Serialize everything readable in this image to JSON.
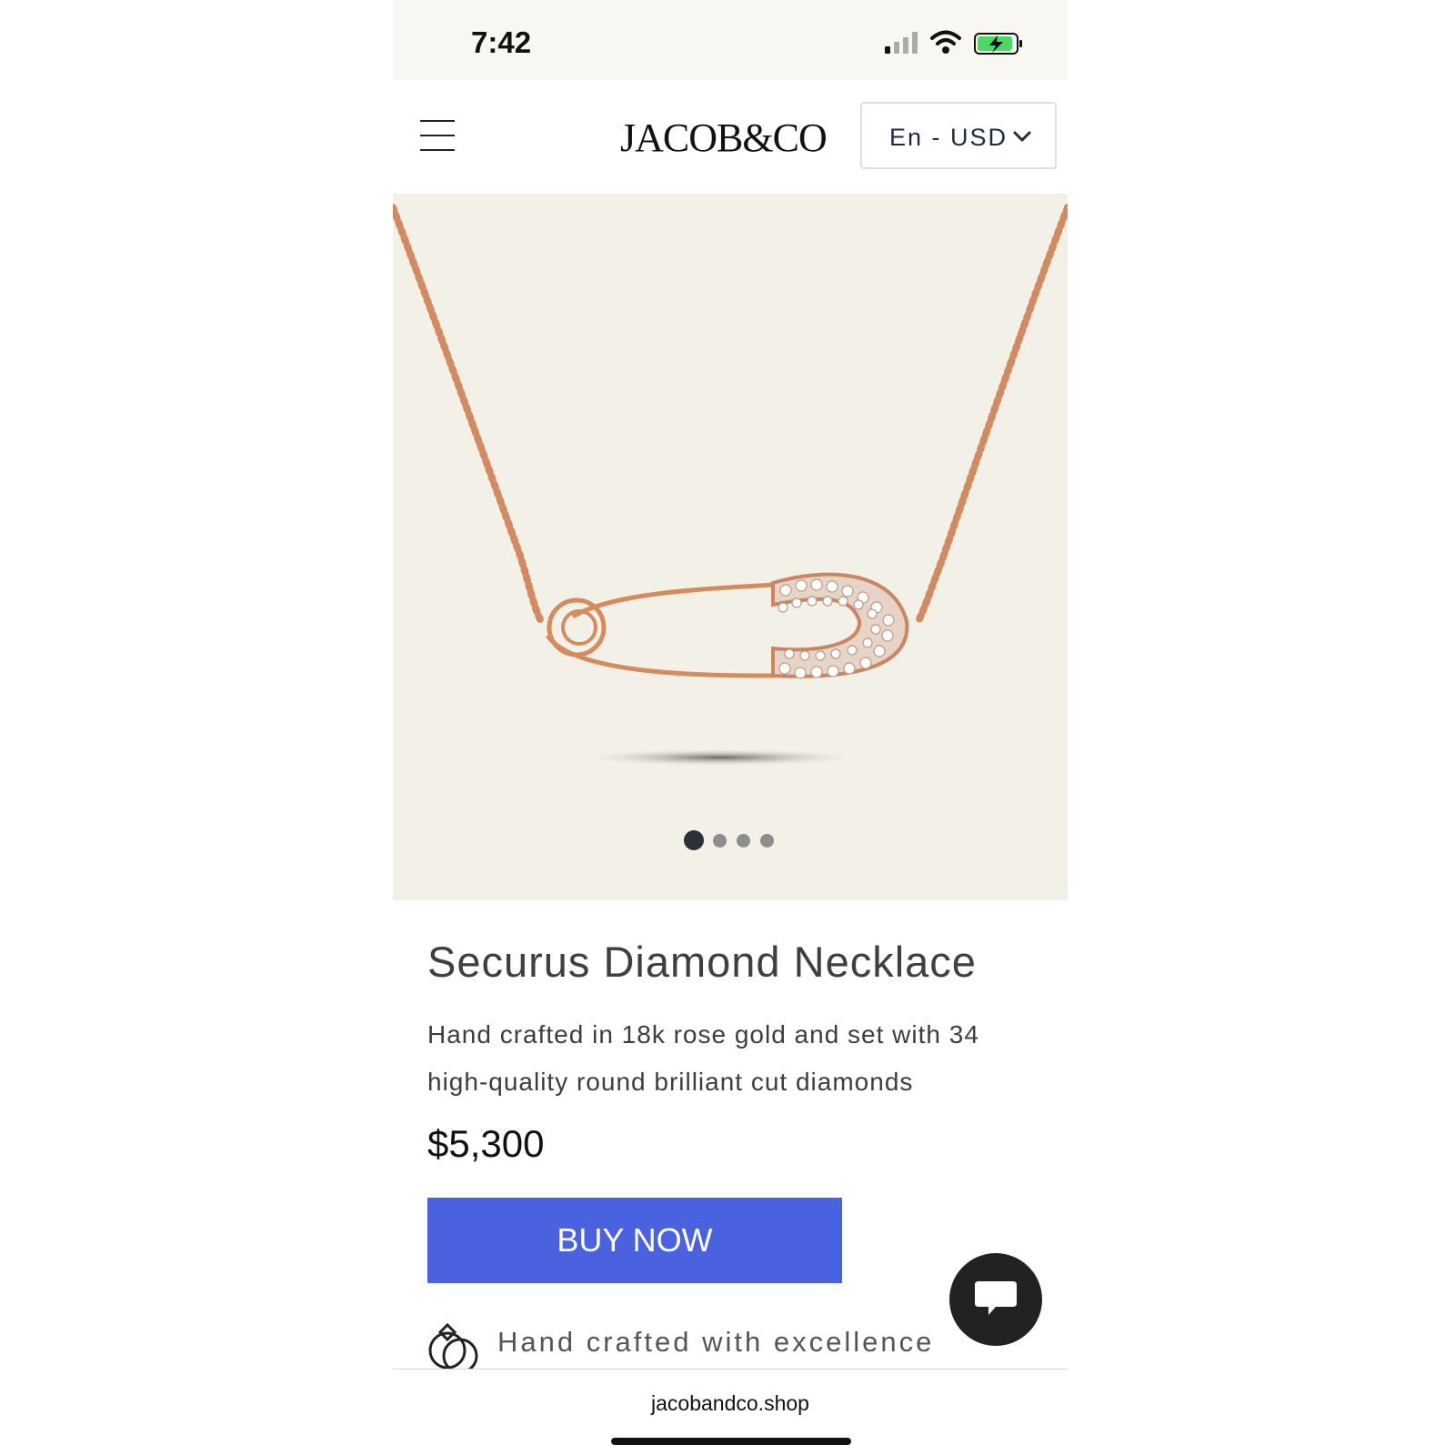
{
  "status_bar": {
    "time": "7:42",
    "icons": [
      "cellular-signal-icon",
      "wifi-icon",
      "battery-charging-icon"
    ],
    "battery_color": "#4cd964"
  },
  "header": {
    "logo": "JACOB&CO",
    "locale": "En - USD",
    "icons": [
      "menu-icon",
      "chevron-down-icon"
    ]
  },
  "product": {
    "image_alt_icon": "diamond-safety-pin-necklace",
    "carousel": {
      "count": 4,
      "active_index": 0
    },
    "title": "Securus Diamond Necklace",
    "description": "Hand crafted in 18k rose gold and set with 34 high-quality round brilliant cut diamonds",
    "price": "$5,300",
    "buy_label": "BUY NOW",
    "feature_text": "Hand crafted with excellence",
    "feature_icon": "rings-icon"
  },
  "browser": {
    "domain": "jacobandco.shop"
  },
  "colors": {
    "accent": "#4a61e0",
    "gallery_bg": "#f3f0e8",
    "status_bg": "#f8f7f2",
    "chat_button": "#222222"
  }
}
